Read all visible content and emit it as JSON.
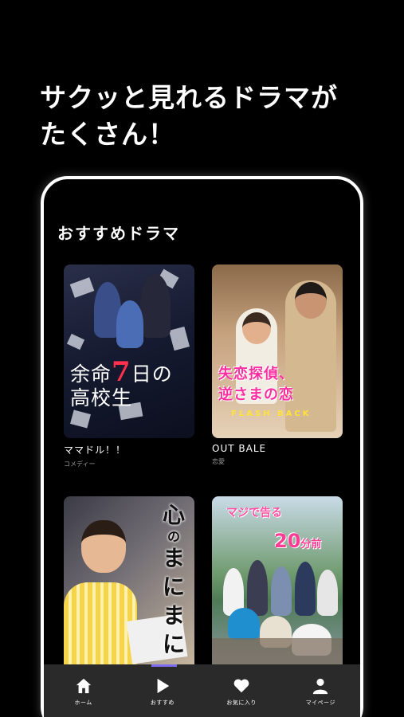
{
  "headline": {
    "line1": "サクッと見れるドラマが",
    "line2": "たくさん！"
  },
  "section_title": "おすすめドラマ",
  "dramas": [
    {
      "title": "ママドル！！",
      "genre": "コメディー",
      "poster_text": [
        "余命",
        "7",
        "日の",
        "高校生"
      ]
    },
    {
      "title": "OUT BALE",
      "genre": "恋愛",
      "poster_text": [
        "失恋探偵、",
        "逆さまの恋",
        "FLASH BACK"
      ]
    },
    {
      "title": "",
      "genre": "",
      "poster_text": [
        "心",
        "の",
        "ま",
        "に",
        "ま",
        "に"
      ]
    },
    {
      "title": "",
      "genre": "",
      "poster_text": [
        "マジで告る",
        "20",
        "分前"
      ]
    }
  ],
  "tabs": [
    {
      "label": "ホーム",
      "icon": "home-icon"
    },
    {
      "label": "おすすめ",
      "icon": "play-icon"
    },
    {
      "label": "お気に入り",
      "icon": "heart-icon"
    },
    {
      "label": "マイページ",
      "icon": "user-icon"
    }
  ],
  "colors": {
    "active_tab_indicator": "#7d6cf0",
    "accent_pink": "#ff2ea0"
  }
}
